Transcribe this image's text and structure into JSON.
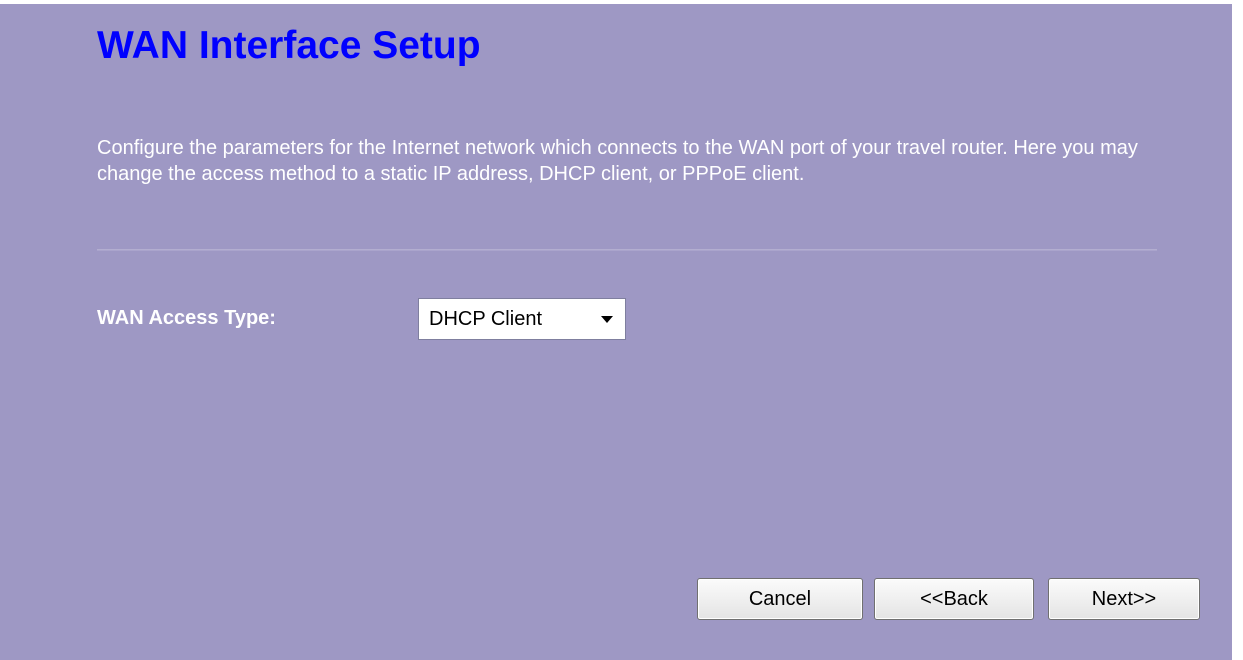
{
  "page": {
    "title": "WAN Interface Setup",
    "description": "Configure the parameters for the Internet network which connects to the WAN port of your travel router. Here you may change the access method to a static IP address, DHCP client, or PPPoE client."
  },
  "wan_access": {
    "label": "WAN Access Type:",
    "selected": "DHCP Client"
  },
  "buttons": {
    "cancel": "Cancel",
    "back": "<<Back",
    "next": "Next>>"
  },
  "colors": {
    "background": "#9e98c4",
    "title": "#0000ff",
    "text": "#ffffff"
  }
}
